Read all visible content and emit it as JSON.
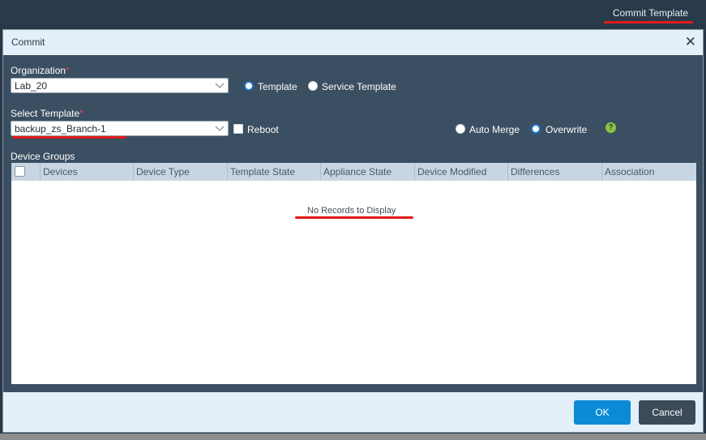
{
  "topbar": {
    "link": "Commit Template"
  },
  "modal": {
    "title": "Commit",
    "organization": {
      "label": "Organization",
      "required": "*",
      "value": "Lab_20"
    },
    "template_type": {
      "options": [
        "Template",
        "Service Template"
      ],
      "selected": "Template"
    },
    "select_template": {
      "label": "Select Template",
      "required": "*",
      "value": "backup_zs_Branch-1"
    },
    "reboot": {
      "label": "Reboot",
      "checked": false
    },
    "merge_mode": {
      "options": [
        "Auto Merge",
        "Overwrite"
      ],
      "selected": "Overwrite"
    },
    "help_icon": "help-icon",
    "device_groups": {
      "label": "Device Groups",
      "columns": [
        "Devices",
        "Device Type",
        "Template State",
        "Appliance State",
        "Device Modified",
        "Differences",
        "Association"
      ],
      "empty_text": "No Records to Display"
    },
    "buttons": {
      "ok": "OK",
      "cancel": "Cancel"
    }
  },
  "colors": {
    "accent_blue": "#0b8bd6",
    "annotation_red": "#e01b1b",
    "help_green": "#8cc63f"
  }
}
